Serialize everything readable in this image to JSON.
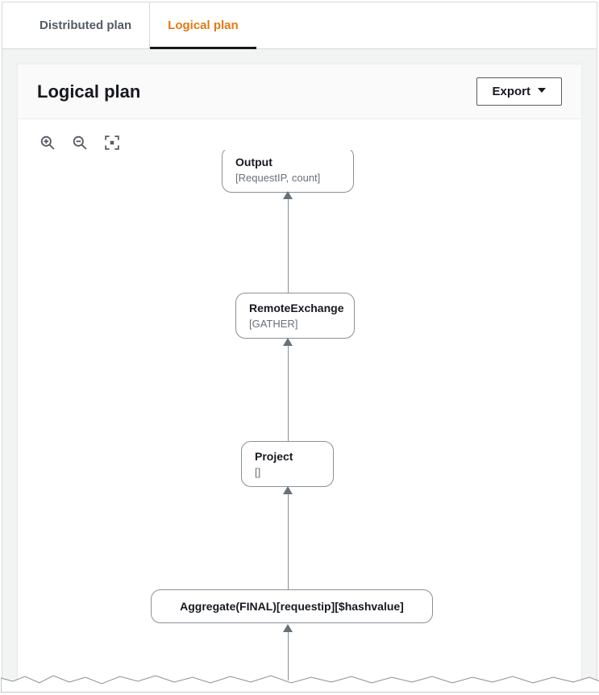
{
  "tabs": {
    "distributed": "Distributed plan",
    "logical": "Logical plan"
  },
  "panel": {
    "title": "Logical plan",
    "export_label": "Export"
  },
  "icons": {
    "zoom_in": "zoom-in-icon",
    "zoom_out": "zoom-out-icon",
    "fit": "fit-screen-icon",
    "caret": "caret-down-icon"
  },
  "nodes": {
    "output": {
      "title": "Output",
      "sub": "[RequestIP, count]"
    },
    "remote_exchange": {
      "title": "RemoteExchange",
      "sub": "[GATHER]"
    },
    "project": {
      "title": "Project",
      "sub": "[]"
    },
    "aggregate": {
      "title": "Aggregate(FINAL)[requestip][$hashvalue]"
    }
  }
}
